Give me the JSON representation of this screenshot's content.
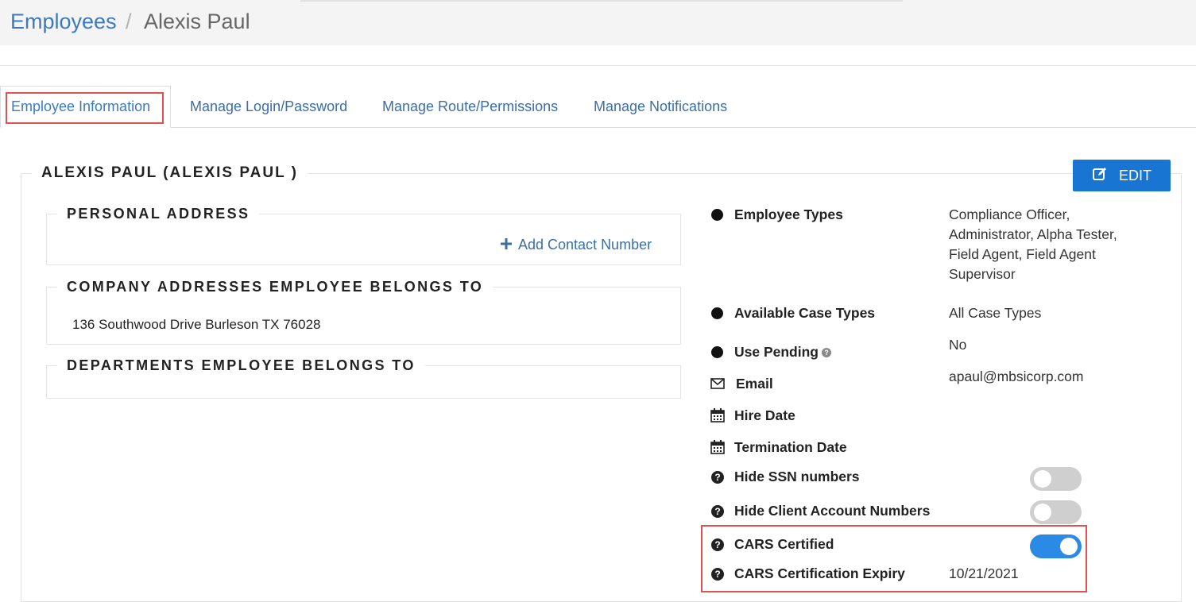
{
  "breadcrumb": {
    "parent": "Employees",
    "separator": "/",
    "current": "Alexis Paul"
  },
  "tabs": [
    {
      "label": "Employee Information",
      "active": true
    },
    {
      "label": "Manage Login/Password",
      "active": false
    },
    {
      "label": "Manage Route/Permissions",
      "active": false
    },
    {
      "label": "Manage Notifications",
      "active": false
    }
  ],
  "panel": {
    "title": "ALEXIS PAUL (ALEXIS PAUL )",
    "edit_label": "EDIT"
  },
  "sections": {
    "personal_address": {
      "title": "PERSONAL ADDRESS",
      "add_contact_label": "Add Contact Number"
    },
    "company_addresses": {
      "title": "COMPANY ADDRESSES EMPLOYEE BELONGS TO",
      "address": "136 Southwood Drive Burleson TX 76028"
    },
    "departments": {
      "title": "DEPARTMENTS EMPLOYEE BELONGS TO"
    }
  },
  "details": {
    "employee_types": {
      "label": "Employee Types",
      "lines": [
        "Compliance Officer,",
        "Administrator, Alpha Tester,",
        "Field Agent, Field Agent",
        "Supervisor"
      ]
    },
    "case_types": {
      "label": "Available Case Types",
      "value": "All Case Types"
    },
    "use_pending": {
      "label": "Use Pending",
      "value": "No"
    },
    "email": {
      "label": "Email",
      "value": "apaul@mbsicorp.com"
    },
    "hire_date": {
      "label": "Hire Date",
      "value": ""
    },
    "termination_date": {
      "label": "Termination Date",
      "value": ""
    },
    "hide_ssn": {
      "label": "Hide SSN numbers",
      "enabled": false
    },
    "hide_client_acct": {
      "label": "Hide Client Account Numbers",
      "enabled": false
    },
    "cars_certified": {
      "label": "CARS Certified",
      "enabled": true
    },
    "cars_expiry": {
      "label": "CARS Certification Expiry",
      "value": "10/21/2021"
    }
  },
  "colors": {
    "accent": "#1875d1",
    "link": "#3a6ea8",
    "highlight": "#e05252",
    "toggle_on": "#2a8ae6",
    "toggle_off": "#cfcfcf"
  },
  "icons": [
    "edit-icon",
    "plus-icon",
    "envelope-icon",
    "calendar-icon",
    "question-circle-icon",
    "bullet-dot-icon"
  ]
}
